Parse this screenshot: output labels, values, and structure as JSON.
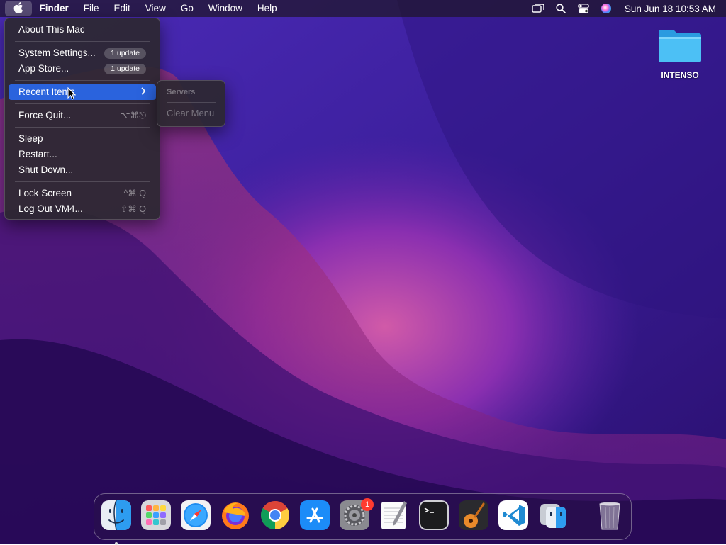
{
  "menubar": {
    "app_name": "Finder",
    "menus": [
      "File",
      "Edit",
      "View",
      "Go",
      "Window",
      "Help"
    ],
    "clock": "Sun Jun 18  10:53 AM",
    "status_icons": [
      "screen-mirroring-icon",
      "spotlight-search-icon",
      "control-center-icon",
      "siri-icon"
    ]
  },
  "apple_menu": {
    "about": "About This Mac",
    "system_settings": "System Settings...",
    "system_settings_badge": "1 update",
    "app_store": "App Store...",
    "app_store_badge": "1 update",
    "recent_items": "Recent Items",
    "force_quit": "Force Quit...",
    "force_quit_shortcut": "⌥⌘⎋",
    "sleep": "Sleep",
    "restart": "Restart...",
    "shut_down": "Shut Down...",
    "lock_screen": "Lock Screen",
    "lock_screen_shortcut": "^⌘ Q",
    "log_out": "Log Out VM4...",
    "log_out_shortcut": "⇧⌘ Q"
  },
  "recent_submenu": {
    "header": "Servers",
    "clear": "Clear Menu"
  },
  "desktop": {
    "icon_label": "INTENSO",
    "icon": "folder-icon"
  },
  "dock": {
    "apps": [
      "finder-icon",
      "launchpad-icon",
      "safari-icon",
      "firefox-icon",
      "chrome-icon",
      "app-store-icon",
      "system-settings-icon",
      "textedit-icon",
      "terminal-icon",
      "garageband-icon",
      "vscode-icon",
      "migration-assistant-icon",
      "trash-icon"
    ],
    "system_settings_badge": "1",
    "running_app": "Finder"
  },
  "colors": {
    "highlight": "#2a63dd",
    "badge_red": "#ff3b30"
  }
}
